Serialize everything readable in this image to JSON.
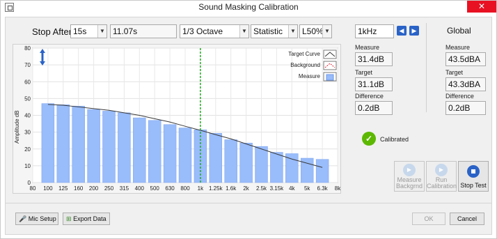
{
  "window": {
    "title": "Sound Masking Calibration",
    "close_glyph": "✕"
  },
  "controls": {
    "stop_after_label": "Stop After",
    "stop_after_value": "15s",
    "elapsed": "11.07s",
    "band": "1/3 Octave",
    "mode": "Statistic",
    "percentile": "L50%"
  },
  "band_panel": {
    "frequency": "1kHz",
    "measure_label": "Measure",
    "measure_value": "31.4dB",
    "target_label": "Target",
    "target_value": "31.1dB",
    "difference_label": "Difference",
    "difference_value": "0.2dB"
  },
  "global_panel": {
    "title": "Global",
    "measure_label": "Measure",
    "measure_value": "43.5dBA",
    "target_label": "Target",
    "target_value": "43.3dBA",
    "difference_label": "Difference",
    "difference_value": "0.2dB"
  },
  "status": {
    "text": "Calibrated",
    "color": "#5cb800"
  },
  "action_buttons": {
    "measure_backgrnd": "Measure\nBackgrnd",
    "run_calibration": "Run\nCalibration",
    "stop_test": "Stop Test"
  },
  "footer": {
    "mic_setup": "Mic Setup",
    "export_data": "Export Data",
    "ok": "OK",
    "cancel": "Cancel"
  },
  "legend": [
    "Target Curve",
    "Background",
    "Measure"
  ],
  "chart_data": {
    "type": "bar",
    "ylabel": "Amplitude dB",
    "ylim": [
      0,
      80
    ],
    "yticks": [
      0,
      10,
      20,
      30,
      40,
      50,
      60,
      70,
      80
    ],
    "categories": [
      "100",
      "125",
      "160",
      "200",
      "250",
      "315",
      "400",
      "500",
      "630",
      "800",
      "1k",
      "1.25k",
      "1.6k",
      "2k",
      "2.5k",
      "3.15k",
      "4k",
      "5k",
      "6.3k"
    ],
    "xticks": [
      "80",
      "100",
      "125",
      "160",
      "200",
      "250",
      "315",
      "400",
      "500",
      "630",
      "800",
      "1k",
      "1.25k",
      "1.6k",
      "2k",
      "2.5k",
      "3.15k",
      "4k",
      "5k",
      "6.3k",
      "8k"
    ],
    "measure": [
      47,
      46.3,
      45.5,
      43.5,
      42.5,
      41.5,
      38.5,
      37,
      34.5,
      32.5,
      31.4,
      29.3,
      25.5,
      23.5,
      21.5,
      18,
      17.2,
      14.5,
      13.8
    ],
    "target": [
      46.5,
      46,
      45,
      44,
      43,
      41.5,
      40,
      38,
      36,
      33.5,
      31.1,
      28.5,
      26,
      23,
      20,
      17,
      14,
      11.5,
      9
    ],
    "selected_band": "1k",
    "colors": {
      "bar": "#99bcfa",
      "bar_edge": "#7aa2ee",
      "target_line": "#3a3a3a",
      "cursor": "#22aa22"
    }
  }
}
